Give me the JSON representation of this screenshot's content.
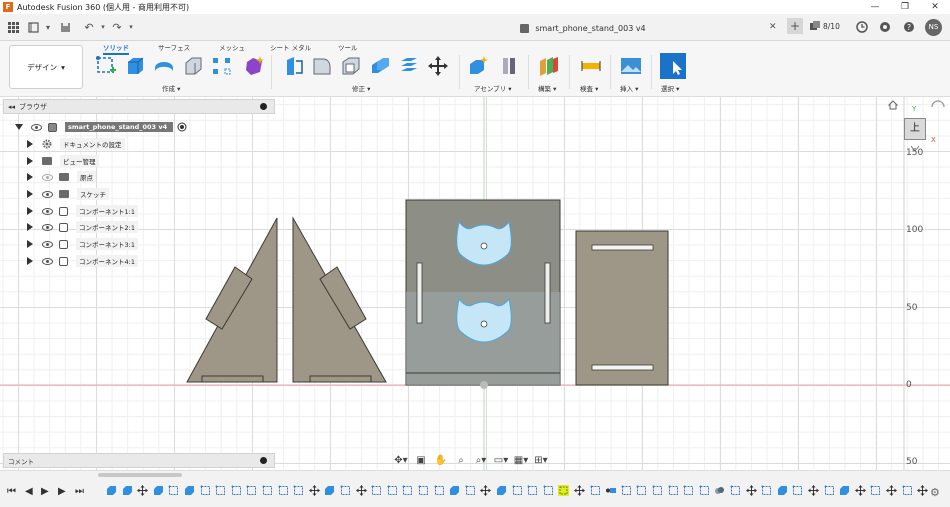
{
  "titlebar": {
    "title": "Autodesk Fusion 360 (個人用 - 商用利用不可)",
    "logo": "F"
  },
  "tabbar": {
    "document_title": "smart_phone_stand_003 v4",
    "jobs": "8/10",
    "user_initials": "NS"
  },
  "ribbon": {
    "workspace": "デザイン",
    "tabs": [
      "ソリッド",
      "サーフェス",
      "メッシュ",
      "シート メタル",
      "ツール"
    ],
    "groups": [
      "作成",
      "修正",
      "アセンブリ",
      "構築",
      "検査",
      "挿入",
      "選択"
    ]
  },
  "browser": {
    "title": "ブラウザ",
    "root": "smart_phone_stand_003 v4",
    "items": [
      {
        "label": "ドキュメントの設定",
        "icon": "gear-icon"
      },
      {
        "label": "ビュー管理",
        "icon": "folder-icon"
      },
      {
        "label": "原点",
        "icon": "folder-icon"
      },
      {
        "label": "スケッチ",
        "icon": "folder-icon"
      },
      {
        "label": "コンポーネント1:1",
        "icon": "component-icon"
      },
      {
        "label": "コンポーネント2:1",
        "icon": "component-icon"
      },
      {
        "label": "コンポーネント3:1",
        "icon": "component-icon"
      },
      {
        "label": "コンポーネント4:1",
        "icon": "component-icon"
      }
    ]
  },
  "comments": {
    "title": "コメント"
  },
  "viewcube": {
    "face": "上",
    "axis_y": "Y",
    "axis_x": "X"
  },
  "ruler": [
    "150",
    "100",
    "50",
    "0",
    "50"
  ],
  "colors": {
    "part_fill": "#9e9788",
    "part_stroke": "#3e3a33",
    "highlight": "#c5e6f6",
    "highlight_stroke": "#4aa8dc",
    "accent": "#1a73c9"
  }
}
